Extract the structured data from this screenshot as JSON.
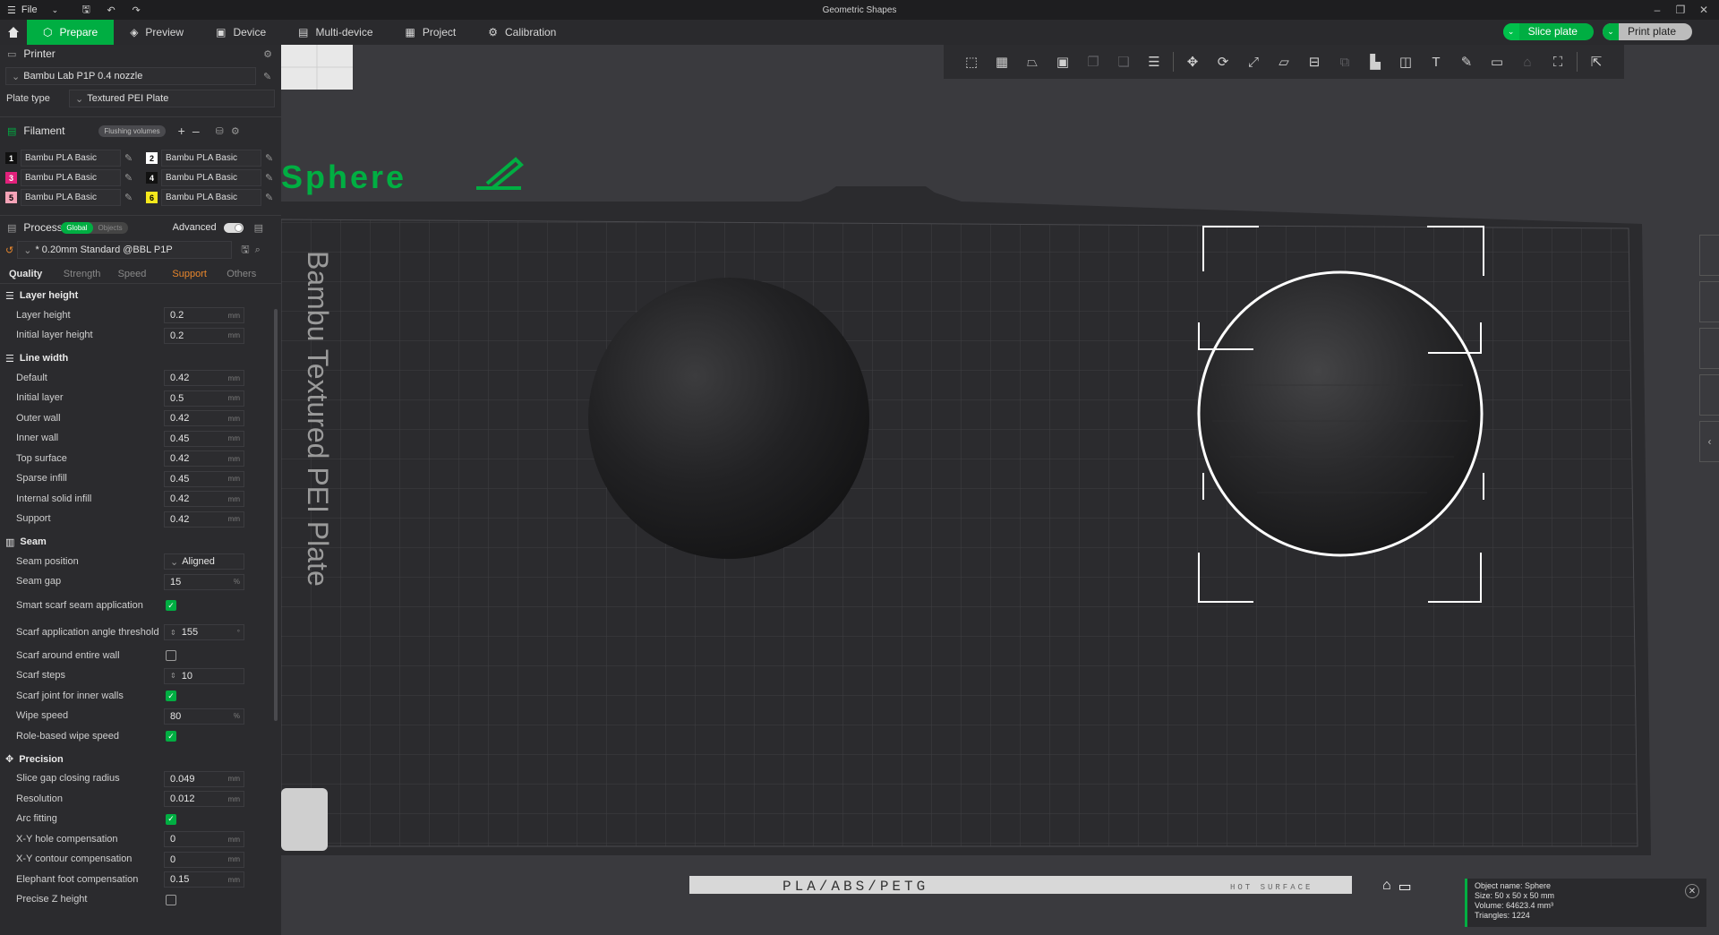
{
  "app": {
    "title": "Geometric Shapes",
    "menu_label": "File"
  },
  "tabs": [
    {
      "label": "Prepare",
      "icon": "prepare-icon"
    },
    {
      "label": "Preview",
      "icon": "preview-icon"
    },
    {
      "label": "Device",
      "icon": "device-icon"
    },
    {
      "label": "Multi-device",
      "icon": "multi-device-icon"
    },
    {
      "label": "Project",
      "icon": "project-icon"
    },
    {
      "label": "Calibration",
      "icon": "calibration-icon"
    }
  ],
  "actions": {
    "slice": "Slice plate",
    "print": "Print plate"
  },
  "printer": {
    "section": "Printer",
    "name": "Bambu Lab P1P 0.4 nozzle",
    "plate_type_label": "Plate type",
    "plate_type": "Textured PEI Plate"
  },
  "filament": {
    "section": "Filament",
    "flushing": "Flushing volumes",
    "items": [
      {
        "num": "1",
        "color": "#111111",
        "text": "#ffffff",
        "name": "Bambu PLA Basic"
      },
      {
        "num": "2",
        "color": "#ffffff",
        "text": "#000000",
        "name": "Bambu PLA Basic"
      },
      {
        "num": "3",
        "color": "#e2217b",
        "text": "#ffffff",
        "name": "Bambu PLA Basic"
      },
      {
        "num": "4",
        "color": "#111111",
        "text": "#ffffff",
        "name": "Bambu PLA Basic"
      },
      {
        "num": "5",
        "color": "#f5a3b7",
        "text": "#000000",
        "name": "Bambu PLA Basic"
      },
      {
        "num": "6",
        "color": "#f5e81c",
        "text": "#000000",
        "name": "Bambu PLA Basic"
      }
    ]
  },
  "process": {
    "section": "Process",
    "global": "Global",
    "objects": "Objects",
    "advanced": "Advanced",
    "preset": "* 0.20mm Standard @BBL P1P",
    "subtabs": [
      "Quality",
      "Strength",
      "Speed",
      "Support",
      "Others"
    ]
  },
  "groups": {
    "layer_height": {
      "title": "Layer height",
      "options": [
        {
          "label": "Layer height",
          "value": "0.2",
          "unit": "mm"
        },
        {
          "label": "Initial layer height",
          "value": "0.2",
          "unit": "mm"
        }
      ]
    },
    "line_width": {
      "title": "Line width",
      "options": [
        {
          "label": "Default",
          "value": "0.42",
          "unit": "mm"
        },
        {
          "label": "Initial layer",
          "value": "0.5",
          "unit": "mm"
        },
        {
          "label": "Outer wall",
          "value": "0.42",
          "unit": "mm"
        },
        {
          "label": "Inner wall",
          "value": "0.45",
          "unit": "mm"
        },
        {
          "label": "Top surface",
          "value": "0.42",
          "unit": "mm"
        },
        {
          "label": "Sparse infill",
          "value": "0.45",
          "unit": "mm"
        },
        {
          "label": "Internal solid infill",
          "value": "0.42",
          "unit": "mm"
        },
        {
          "label": "Support",
          "value": "0.42",
          "unit": "mm"
        }
      ]
    },
    "seam": {
      "title": "Seam",
      "seam_position_label": "Seam position",
      "seam_position": "Aligned",
      "seam_gap_label": "Seam gap",
      "seam_gap": "15",
      "seam_gap_unit": "%",
      "smart_scarf_label": "Smart scarf seam application",
      "scarf_angle_label": "Scarf application angle threshold",
      "scarf_angle": "155",
      "scarf_angle_unit": "°",
      "scarf_entire_label": "Scarf around entire wall",
      "scarf_steps_label": "Scarf steps",
      "scarf_steps": "10",
      "scarf_inner_label": "Scarf joint for inner walls",
      "wipe_speed_label": "Wipe speed",
      "wipe_speed": "80",
      "wipe_speed_unit": "%",
      "role_wipe_label": "Role-based wipe speed"
    },
    "precision": {
      "title": "Precision",
      "slice_gap_label": "Slice gap closing radius",
      "slice_gap": "0.049",
      "resolution_label": "Resolution",
      "resolution": "0.012",
      "arc_label": "Arc fitting",
      "xy_hole_label": "X-Y hole compensation",
      "xy_hole": "0",
      "xy_contour_label": "X-Y contour compensation",
      "xy_contour": "0",
      "elephant_label": "Elephant foot compensation",
      "elephant": "0.15",
      "precise_z_label": "Precise Z height",
      "unit": "mm"
    }
  },
  "plate": {
    "plate_name": "Sphere",
    "bed_label": "Bambu Textured PEI Plate",
    "front_text": "PLA/ABS/PETG",
    "hot_text": "HOT SURFACE"
  },
  "object_info": {
    "name": "Object name: Sphere",
    "size": "Size: 50 x 50 x 50 mm",
    "volume": "Volume: 64623.4 mm³",
    "triangles": "Triangles: 1224"
  },
  "colors": {
    "accent": "#00ae42",
    "warn": "#e8862c"
  }
}
